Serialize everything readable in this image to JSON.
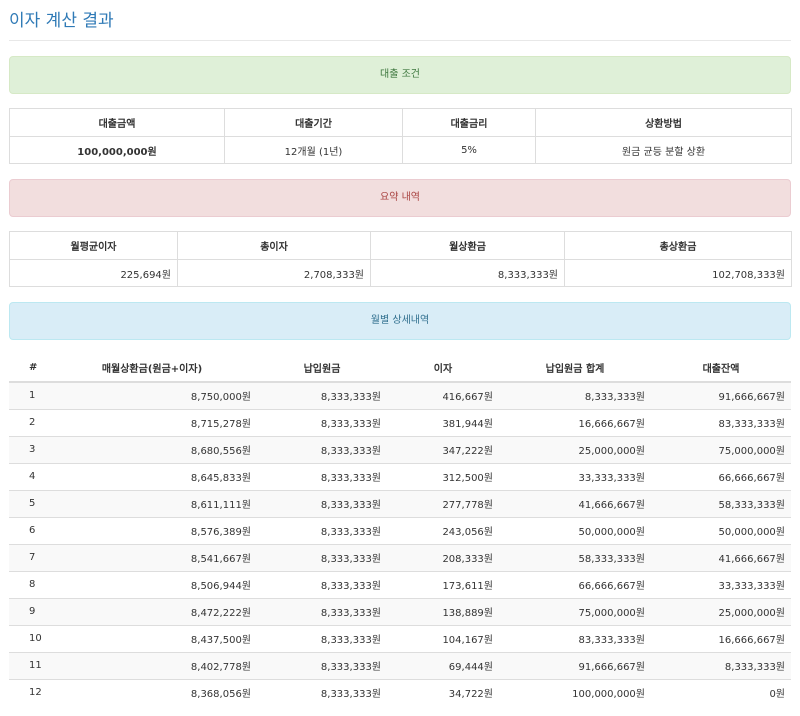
{
  "page": {
    "title": "이자 계산 결과"
  },
  "conditions": {
    "heading": "대출 조건",
    "headers": [
      "대출금액",
      "대출기간",
      "대출금리",
      "상환방법"
    ],
    "values": [
      "100,000,000원",
      "12개월 (1년)",
      "5%",
      "원금 균등 분할 상환"
    ]
  },
  "summary": {
    "heading": "요약 내역",
    "headers": [
      "월평균이자",
      "총이자",
      "월상환금",
      "총상환금"
    ],
    "values": [
      "225,694원",
      "2,708,333원",
      "8,333,333원",
      "102,708,333원"
    ]
  },
  "detail": {
    "heading": "월별 상세내역",
    "headers": [
      "#",
      "매월상환금(원금+이자)",
      "납입원금",
      "이자",
      "납입원금 합계",
      "대출잔액"
    ],
    "rows": [
      [
        "1",
        "8,750,000원",
        "8,333,333원",
        "416,667원",
        "8,333,333원",
        "91,666,667원"
      ],
      [
        "2",
        "8,715,278원",
        "8,333,333원",
        "381,944원",
        "16,666,667원",
        "83,333,333원"
      ],
      [
        "3",
        "8,680,556원",
        "8,333,333원",
        "347,222원",
        "25,000,000원",
        "75,000,000원"
      ],
      [
        "4",
        "8,645,833원",
        "8,333,333원",
        "312,500원",
        "33,333,333원",
        "66,666,667원"
      ],
      [
        "5",
        "8,611,111원",
        "8,333,333원",
        "277,778원",
        "41,666,667원",
        "58,333,333원"
      ],
      [
        "6",
        "8,576,389원",
        "8,333,333원",
        "243,056원",
        "50,000,000원",
        "50,000,000원"
      ],
      [
        "7",
        "8,541,667원",
        "8,333,333원",
        "208,333원",
        "58,333,333원",
        "41,666,667원"
      ],
      [
        "8",
        "8,506,944원",
        "8,333,333원",
        "173,611원",
        "66,666,667원",
        "33,333,333원"
      ],
      [
        "9",
        "8,472,222원",
        "8,333,333원",
        "138,889원",
        "75,000,000원",
        "25,000,000원"
      ],
      [
        "10",
        "8,437,500원",
        "8,333,333원",
        "104,167원",
        "83,333,333원",
        "16,666,667원"
      ],
      [
        "11",
        "8,402,778원",
        "8,333,333원",
        "69,444원",
        "91,666,667원",
        "8,333,333원"
      ],
      [
        "12",
        "8,368,056원",
        "8,333,333원",
        "34,722원",
        "100,000,000원",
        "0원"
      ]
    ]
  }
}
